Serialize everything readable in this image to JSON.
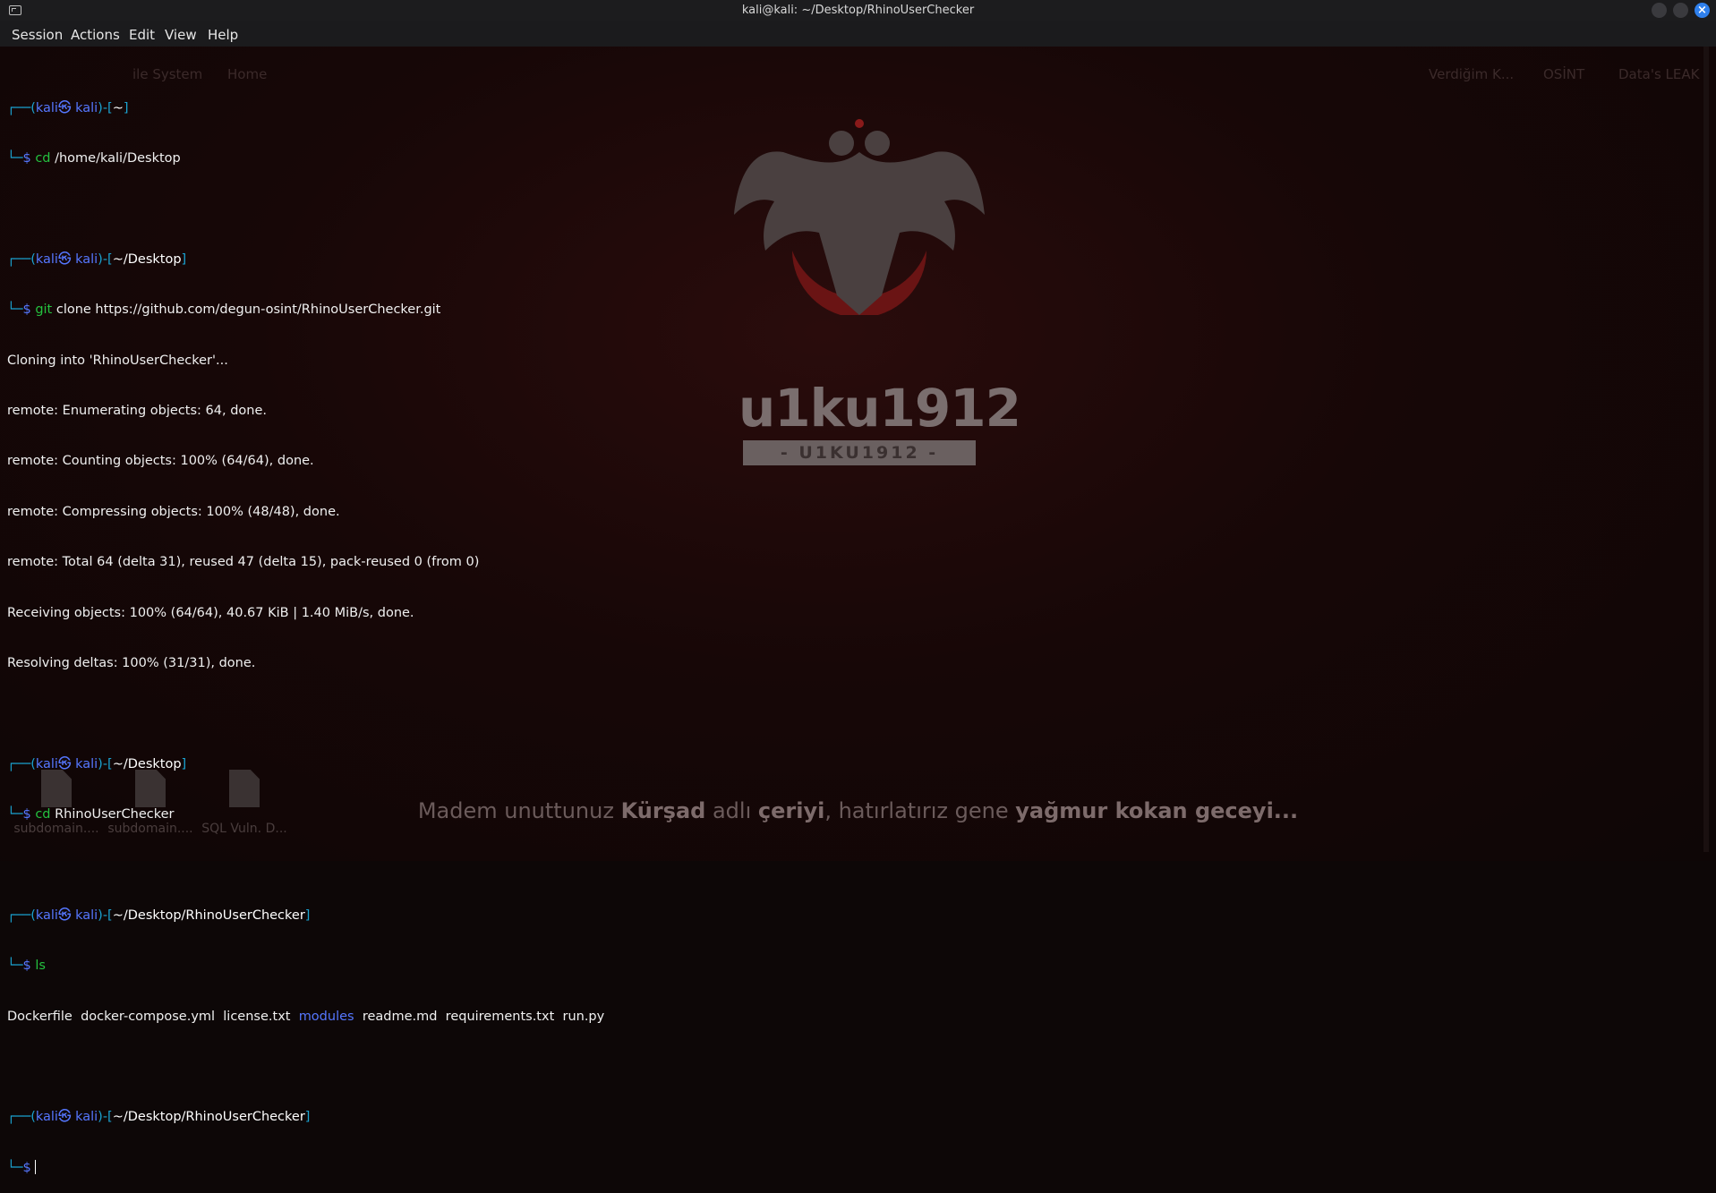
{
  "window": {
    "title": "kali@kali: ~/Desktop/RhinoUserChecker"
  },
  "menu": [
    "Session",
    "Actions",
    "Edit",
    "View",
    "Help"
  ],
  "desktop": {
    "ghost_items": [
      "ile System",
      "Home",
      "Verdiğim K...",
      "OSİNT",
      "Data's LEAK I"
    ],
    "brand": "u1ku1912",
    "brand_sub": "- U1KU1912 -",
    "quote": {
      "part1": "Madem unuttunuz ",
      "bold1": "Kürşad",
      "part2": " adlı ",
      "bold2": "çeriyi",
      "part3": ", hatırlatırız gene ",
      "bold3": "yağmur kokan geceyi..."
    },
    "icons": [
      "subdomain....",
      "subdomain....",
      "SQL Vuln. D..."
    ]
  },
  "prompt": {
    "open": "┌──(",
    "user": "kali",
    "skull": "㉿",
    "host": "kali",
    "mid": ")-[",
    "close": "]",
    "cont": "└─",
    "dollar": "$"
  },
  "session": {
    "p1_path": "~",
    "cmd1": "cd",
    "cmd1_args": "/home/kali/Desktop",
    "p2_path": "~/Desktop",
    "cmd2": "git",
    "cmd2_args": "clone https://github.com/degun-osint/RhinoUserChecker.git",
    "clone_output": [
      "Cloning into 'RhinoUserChecker'...",
      "remote: Enumerating objects: 64, done.",
      "remote: Counting objects: 100% (64/64), done.",
      "remote: Compressing objects: 100% (48/48), done.",
      "remote: Total 64 (delta 31), reused 47 (delta 15), pack-reused 0 (from 0)",
      "Receiving objects: 100% (64/64), 40.67 KiB | 1.40 MiB/s, done.",
      "Resolving deltas: 100% (31/31), done."
    ],
    "p3_path": "~/Desktop",
    "cmd3": "cd",
    "cmd3_args": "RhinoUserChecker",
    "p4_path": "~/Desktop/RhinoUserChecker",
    "cmd4": "ls",
    "ls_files": {
      "f1": "Dockerfile",
      "f2": "docker-compose.yml",
      "f3": "license.txt",
      "dir": "modules",
      "f4": "readme.md",
      "f5": "requirements.txt",
      "f6": "run.py"
    },
    "p5_path": "~/Desktop/RhinoUserChecker"
  },
  "colors": {
    "prompt_cyan": "#1aa3d1",
    "prompt_green": "#24c23f",
    "user_blue": "#5577ff",
    "close_button": "#2f80ed"
  }
}
